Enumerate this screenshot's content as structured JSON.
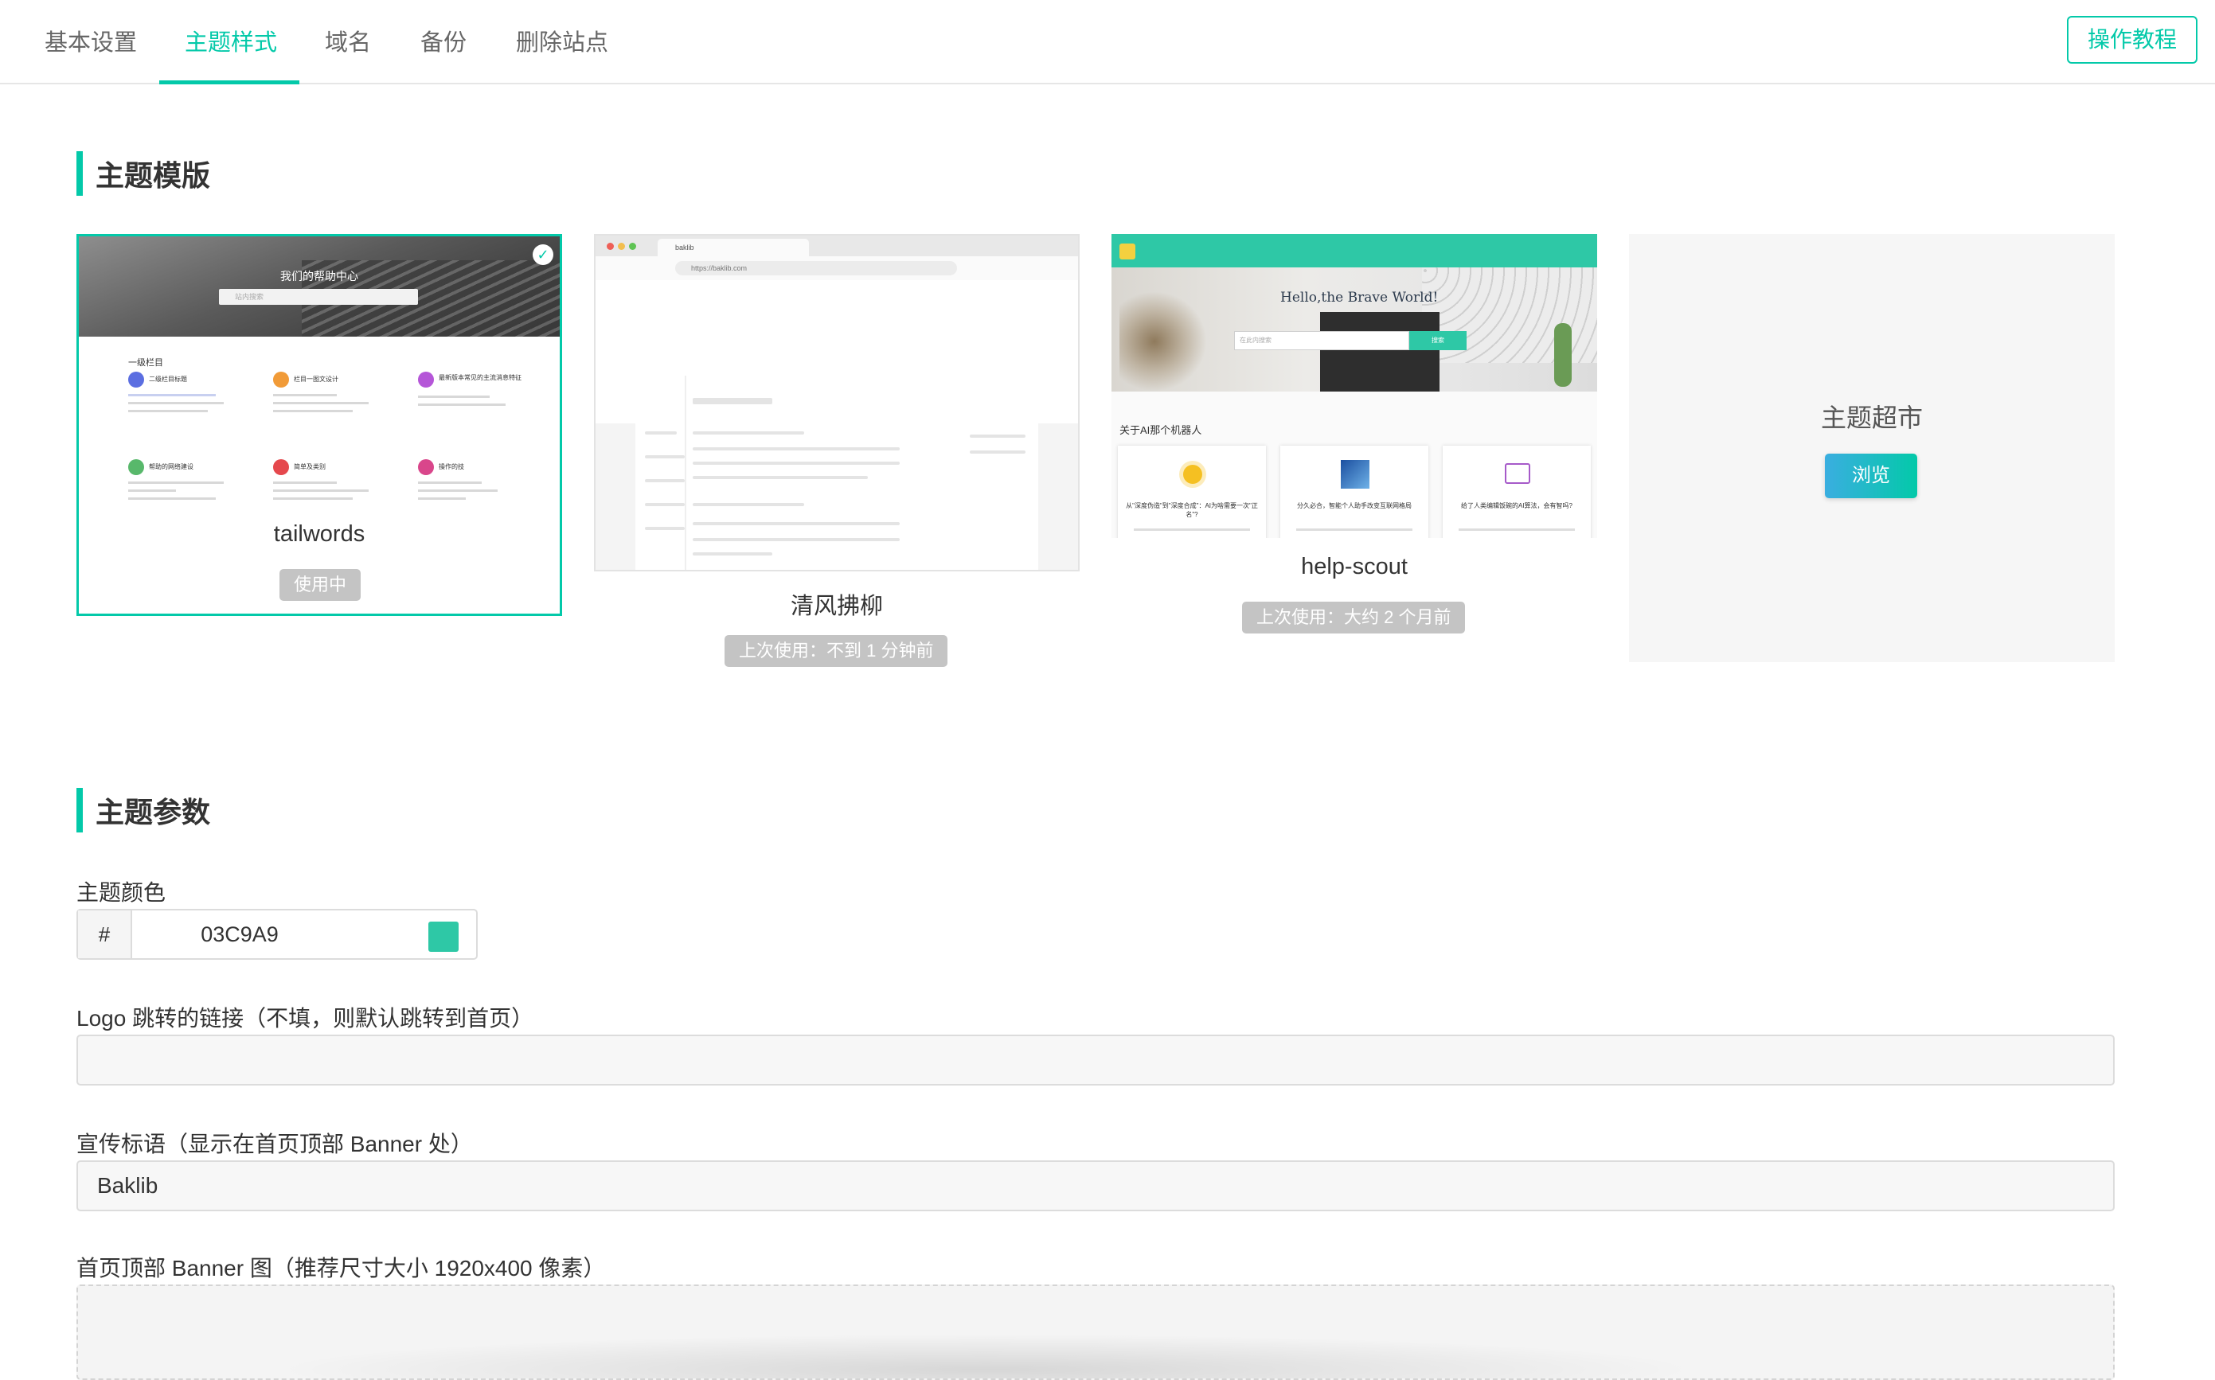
{
  "tabs": [
    {
      "label": "基本设置"
    },
    {
      "label": "主题样式"
    },
    {
      "label": "域名"
    },
    {
      "label": "备份"
    },
    {
      "label": "删除站点"
    }
  ],
  "help_button": "操作教程",
  "accent_color": "#03C9A9",
  "templates_section": {
    "title": "主题模版",
    "cards": [
      {
        "name": "tailwords",
        "status": "使用中",
        "selected": true,
        "preview": {
          "title": "我们的帮助中心",
          "search_placeholder": "站内搜索",
          "category": "一级栏目",
          "tiles": [
            "二级栏目标题",
            "栏目一图文设计",
            "最新版本常见的主流消息特征",
            "帮助的网络建设",
            "简单及类别",
            "操作的技"
          ]
        }
      },
      {
        "name": "清风拂柳",
        "status": "上次使用：不到 1 分钟前",
        "selected": false,
        "preview": {
          "tab_title": "baklib",
          "url": "https://baklib.com"
        }
      },
      {
        "name": "help-scout",
        "status": "上次使用：大约 2 个月前",
        "selected": false,
        "preview": {
          "hero": "Hello,the Brave World!",
          "search_placeholder": "在此内搜索",
          "search_button": "搜索",
          "section_title": "关于AI那个机器人",
          "tiles": [
            "从\"深度伪造\"到\"深度合成\"：AI为啥需要一次\"正名\"?",
            "分久必合，智能个人助手改变互联网格局",
            "给了人类编辑饭碗的AI算法，会有智吗?"
          ]
        }
      }
    ],
    "market": {
      "title": "主题超市",
      "button": "浏览"
    }
  },
  "params_section": {
    "title": "主题参数",
    "theme_color": {
      "label": "主题颜色",
      "prefix": "#",
      "value": "03C9A9",
      "swatch": "#2EC8A6"
    },
    "logo_link": {
      "label": "Logo 跳转的链接（不填，则默认跳转到首页）",
      "value": ""
    },
    "slogan": {
      "label": "宣传标语（显示在首页顶部 Banner 处）",
      "value": "Baklib"
    },
    "banner": {
      "label": "首页顶部 Banner 图（推荐尺寸大小 1920x400 像素）"
    }
  }
}
